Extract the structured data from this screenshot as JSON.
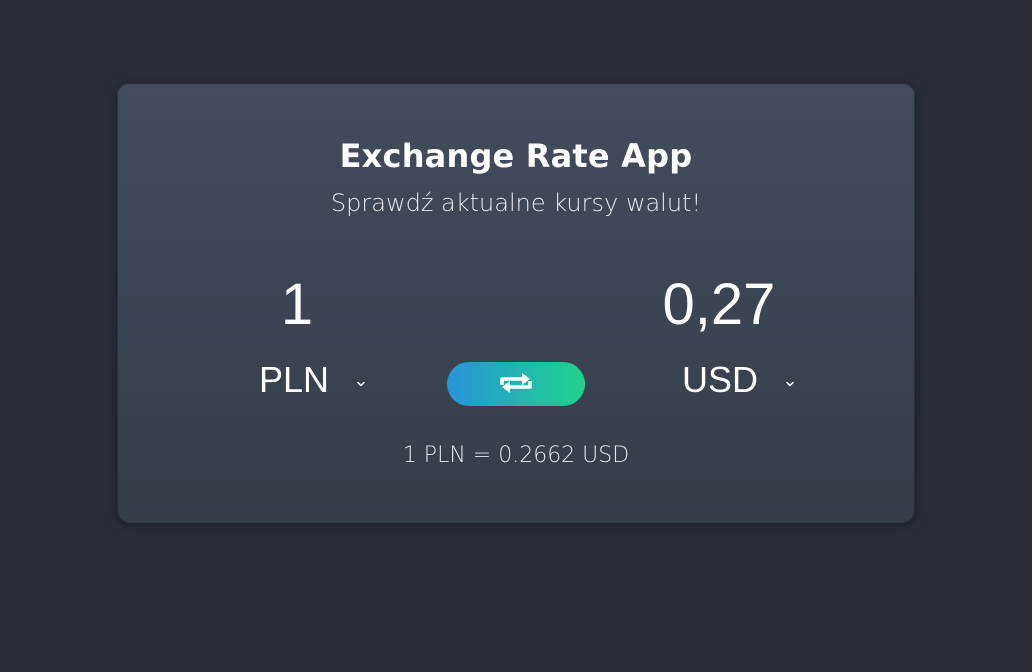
{
  "app": {
    "title": "Exchange Rate App",
    "subtitle": "Sprawdź aktualne kursy walut!"
  },
  "converter": {
    "from_amount": "1",
    "to_amount": "0,27",
    "from_currency": "PLN",
    "to_currency": "USD",
    "swap_icon": "swap-arrows-icon",
    "rate_text": "1 PLN = 0.2662 USD"
  },
  "colors": {
    "background": "#282d39",
    "card_top": "#424c5c",
    "card_bottom": "#353d49",
    "swap_gradient_start": "#2794da",
    "swap_gradient_end": "#1fd38a",
    "text": "#ffffff"
  }
}
